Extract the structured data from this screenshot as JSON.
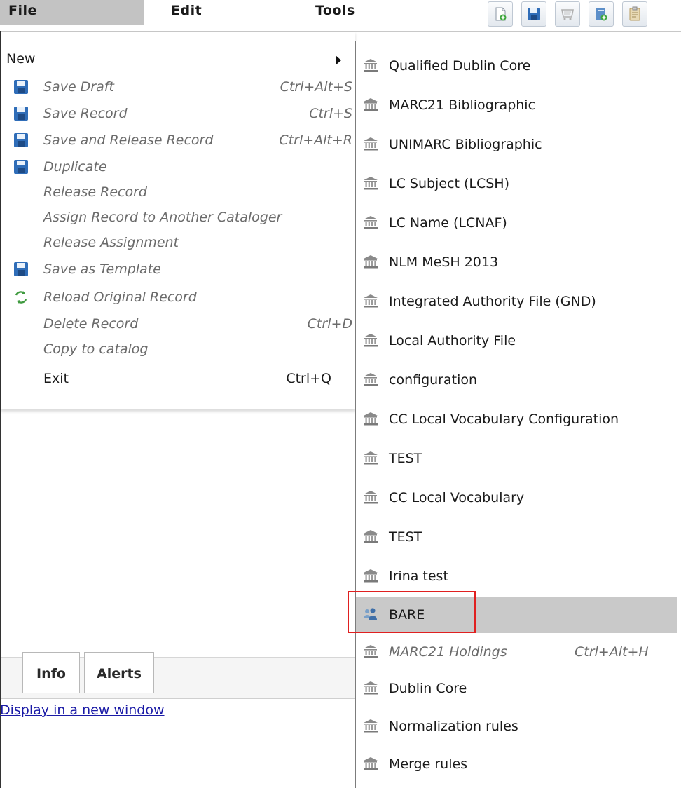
{
  "menubar": {
    "file": "File",
    "edit": "Edit",
    "tools": "Tools",
    "toolbar_icons": [
      "new-document-icon",
      "save-icon",
      "cart-icon",
      "new-record-icon",
      "clipboard-icon"
    ]
  },
  "file_menu": {
    "new": "New",
    "save_draft": {
      "label": "Save Draft",
      "shortcut": "Ctrl+Alt+S"
    },
    "save_record": {
      "label": "Save Record",
      "shortcut": "Ctrl+S"
    },
    "save_release": {
      "label": "Save and Release Record",
      "shortcut": "Ctrl+Alt+R"
    },
    "duplicate": {
      "label": "Duplicate"
    },
    "release_record": {
      "label": "Release Record"
    },
    "assign_record": {
      "label": "Assign Record to Another Cataloger"
    },
    "release_assignment": {
      "label": "Release Assignment"
    },
    "save_template": {
      "label": "Save as Template"
    },
    "reload_original": {
      "label": "Reload Original Record"
    },
    "delete_record": {
      "label": "Delete Record",
      "shortcut": "Ctrl+D"
    },
    "copy_to_catalog": {
      "label": "Copy to catalog"
    },
    "exit": {
      "label": "Exit",
      "shortcut": "Ctrl+Q"
    }
  },
  "submenu": {
    "items": [
      {
        "label": "Qualified Dublin Core"
      },
      {
        "label": "MARC21 Bibliographic"
      },
      {
        "label": "UNIMARC Bibliographic"
      },
      {
        "label": "LC Subject (LCSH)"
      },
      {
        "label": "LC Name (LCNAF)"
      },
      {
        "label": "NLM MeSH 2013"
      },
      {
        "label": "Integrated Authority File (GND)"
      },
      {
        "label": "Local Authority File"
      },
      {
        "label": "configuration"
      },
      {
        "label": "CC Local Vocabulary Configuration"
      },
      {
        "label": "TEST"
      },
      {
        "label": "CC Local Vocabulary"
      },
      {
        "label": "TEST"
      },
      {
        "label": "Irina test"
      },
      {
        "label": "BARE"
      },
      {
        "label": "MARC21 Holdings",
        "shortcut": "Ctrl+Alt+H"
      },
      {
        "label": "Dublin Core"
      },
      {
        "label": "Normalization rules"
      },
      {
        "label": "Merge rules"
      }
    ]
  },
  "tabs": {
    "info": "Info",
    "alerts": "Alerts"
  },
  "links": {
    "display_new_window": "Display in a new window"
  }
}
